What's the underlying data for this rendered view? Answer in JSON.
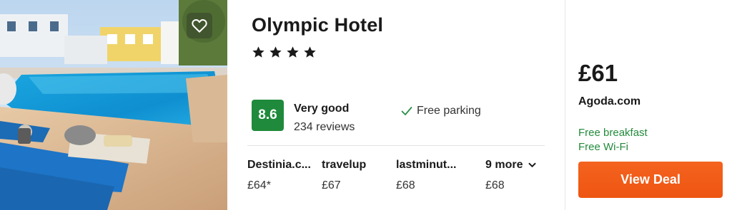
{
  "hotel": {
    "name": "Olympic Hotel",
    "stars": 4,
    "rating_score": "8.6",
    "rating_label": "Very good",
    "reviews": "234 reviews",
    "amenity": "Free parking"
  },
  "providers": [
    {
      "name": "Destinia.c...",
      "price": "£64*"
    },
    {
      "name": "travelup",
      "price": "£67"
    },
    {
      "name": "lastminut...",
      "price": "£68"
    }
  ],
  "more": {
    "label": "9 more",
    "price": "£68"
  },
  "deal": {
    "price": "£61",
    "site": "Agoda.com",
    "perks": [
      "Free breakfast",
      "Free Wi-Fi"
    ],
    "button_label": "View Deal"
  },
  "colors": {
    "rating_badge": "#1f8a3b",
    "perk_text": "#228b3b",
    "cta": "#f15a1a"
  },
  "icons": [
    "heart-icon",
    "star-icon",
    "check-icon",
    "chevron-down-icon"
  ]
}
